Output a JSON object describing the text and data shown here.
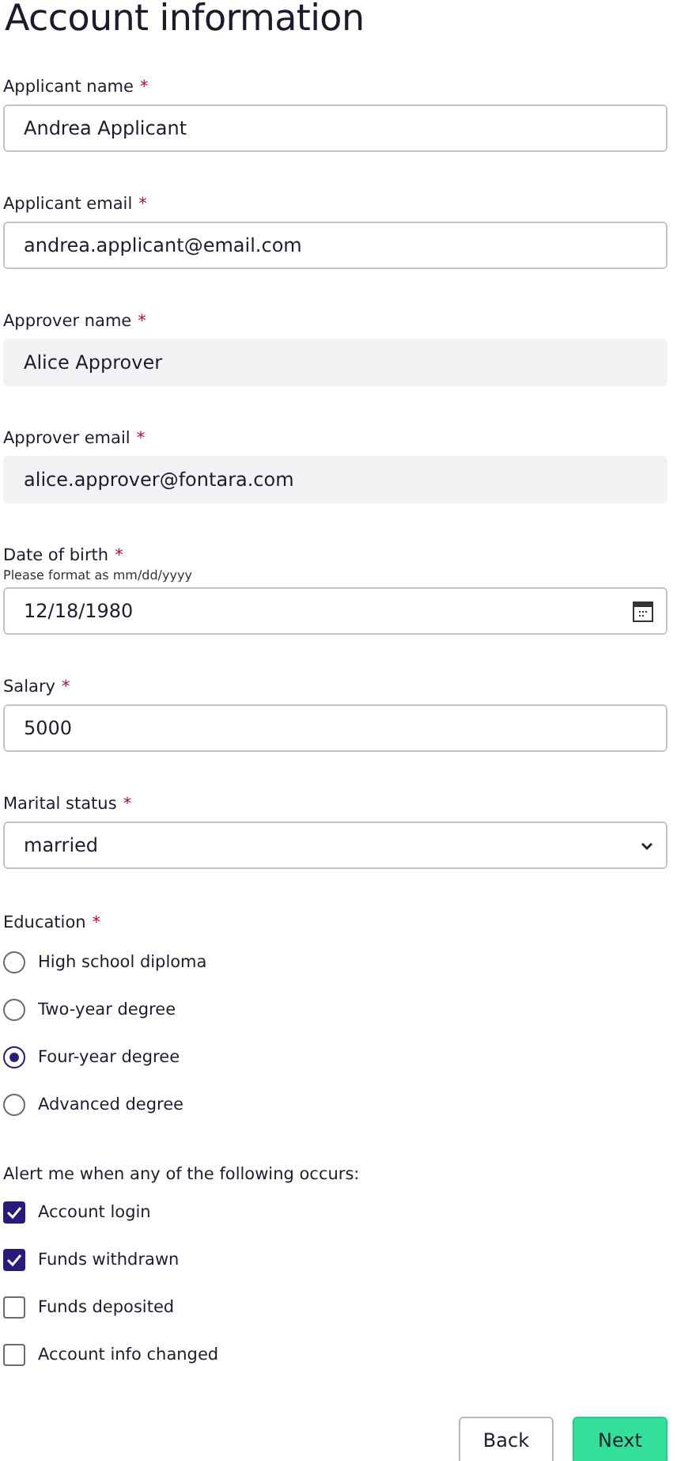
{
  "title": "Account information",
  "fields": [
    {
      "kind": "text",
      "label": "Applicant name",
      "required_mark": "*",
      "value": "Andrea Applicant"
    },
    {
      "kind": "text",
      "label": "Applicant email",
      "required_mark": "*",
      "value": "andrea.applicant@email.com"
    },
    {
      "kind": "readonly",
      "label": "Approver name",
      "required_mark": "*",
      "value": "Alice Approver"
    },
    {
      "kind": "readonly",
      "label": "Approver email",
      "required_mark": "*",
      "value": "alice.approver@fontara.com"
    },
    {
      "kind": "date",
      "label": "Date of birth",
      "required_mark": "*",
      "hint": "Please format as mm/dd/yyyy",
      "value": "12/18/1980"
    },
    {
      "kind": "text",
      "label": "Salary",
      "required_mark": "*",
      "value": "5000"
    },
    {
      "kind": "select",
      "label": "Marital status",
      "required_mark": "*",
      "value": "married"
    }
  ],
  "education": {
    "label": "Education",
    "required_mark": "*",
    "options": [
      {
        "label": "High school diploma",
        "selected": false
      },
      {
        "label": "Two-year degree",
        "selected": false
      },
      {
        "label": "Four-year degree",
        "selected": true
      },
      {
        "label": "Advanced degree",
        "selected": false
      }
    ]
  },
  "alerts": {
    "label": "Alert me when any of the following occurs:",
    "options": [
      {
        "label": "Account login",
        "checked": true
      },
      {
        "label": "Funds withdrawn",
        "checked": true
      },
      {
        "label": "Funds deposited",
        "checked": false
      },
      {
        "label": "Account info changed",
        "checked": false
      }
    ]
  },
  "buttons": [
    {
      "kind": "secondary",
      "label": "Back"
    },
    {
      "kind": "primary",
      "label": "Next"
    }
  ]
}
